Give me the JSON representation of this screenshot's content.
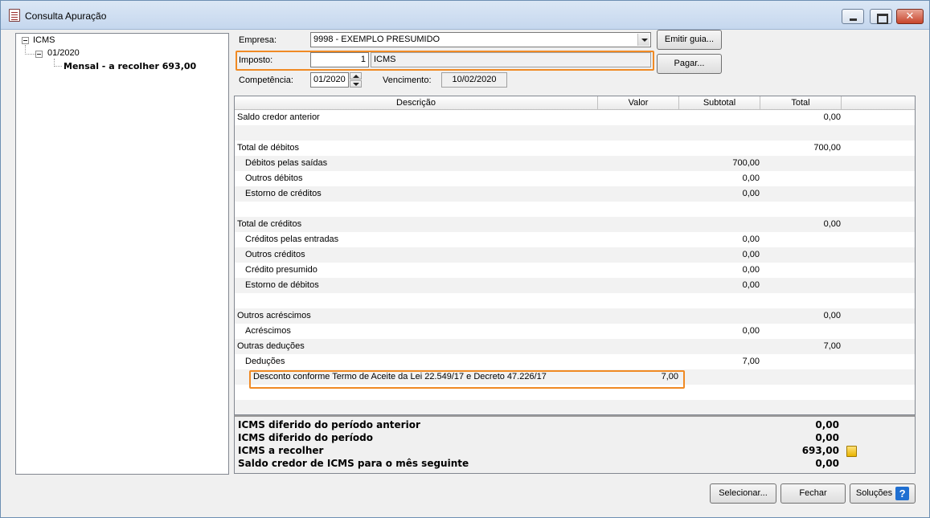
{
  "window": {
    "title": "Consulta Apuração"
  },
  "tree": {
    "root": "ICMS",
    "period": "01/2020",
    "leaf": "Mensal - a recolher 693,00"
  },
  "form": {
    "empresa_label": "Empresa:",
    "empresa_value": "9998 - EXEMPLO PRESUMIDO",
    "imposto_label": "Imposto:",
    "imposto_code": "1",
    "imposto_name": "ICMS",
    "competencia_label": "Competência:",
    "competencia_value": "01/2020",
    "vencimento_label": "Vencimento:",
    "vencimento_value": "10/02/2020",
    "emitir_guia_label": "Emitir guia...",
    "pagar_label": "Pagar..."
  },
  "grid": {
    "columns": [
      "Descrição",
      "Valor",
      "Subtotal",
      "Total"
    ],
    "rows": [
      {
        "desc": "Saldo credor anterior",
        "indent": 0,
        "valor": "",
        "subtotal": "",
        "total": "0,00"
      },
      {
        "desc": "",
        "indent": 0,
        "valor": "",
        "subtotal": "",
        "total": ""
      },
      {
        "desc": "Total de débitos",
        "indent": 0,
        "valor": "",
        "subtotal": "",
        "total": "700,00"
      },
      {
        "desc": "Débitos pelas saídas",
        "indent": 1,
        "valor": "",
        "subtotal": "700,00",
        "total": ""
      },
      {
        "desc": "Outros débitos",
        "indent": 1,
        "valor": "",
        "subtotal": "0,00",
        "total": ""
      },
      {
        "desc": "Estorno de créditos",
        "indent": 1,
        "valor": "",
        "subtotal": "0,00",
        "total": ""
      },
      {
        "desc": "",
        "indent": 0,
        "valor": "",
        "subtotal": "",
        "total": ""
      },
      {
        "desc": "Total de créditos",
        "indent": 0,
        "valor": "",
        "subtotal": "",
        "total": "0,00"
      },
      {
        "desc": "Créditos pelas entradas",
        "indent": 1,
        "valor": "",
        "subtotal": "0,00",
        "total": ""
      },
      {
        "desc": "Outros créditos",
        "indent": 1,
        "valor": "",
        "subtotal": "0,00",
        "total": ""
      },
      {
        "desc": "Crédito presumido",
        "indent": 1,
        "valor": "",
        "subtotal": "0,00",
        "total": ""
      },
      {
        "desc": "Estorno de débitos",
        "indent": 1,
        "valor": "",
        "subtotal": "0,00",
        "total": ""
      },
      {
        "desc": "",
        "indent": 0,
        "valor": "",
        "subtotal": "",
        "total": ""
      },
      {
        "desc": "Outros acréscimos",
        "indent": 0,
        "valor": "",
        "subtotal": "",
        "total": "0,00"
      },
      {
        "desc": "Acréscimos",
        "indent": 1,
        "valor": "",
        "subtotal": "0,00",
        "total": ""
      },
      {
        "desc": "Outras deduções",
        "indent": 0,
        "valor": "",
        "subtotal": "",
        "total": "7,00"
      },
      {
        "desc": "Deduções",
        "indent": 1,
        "valor": "",
        "subtotal": "7,00",
        "total": ""
      },
      {
        "desc": "Desconto conforme Termo de Aceite da Lei 22.549/17 e Decreto 47.226/17",
        "indent": 2,
        "valor": "7,00",
        "subtotal": "",
        "total": ""
      }
    ]
  },
  "summary": [
    {
      "label": "ICMS diferido do período anterior",
      "value": "0,00"
    },
    {
      "label": "ICMS diferido do período",
      "value": "0,00"
    },
    {
      "label": "ICMS a recolher",
      "value": "693,00"
    },
    {
      "label": "Saldo credor de ICMS para o mês seguinte",
      "value": "0,00"
    }
  ],
  "footer": {
    "selecionar_label": "Selecionar...",
    "fechar_label": "Fechar",
    "solucoes_label": "Soluções"
  },
  "colors": {
    "highlight": "#f08a24",
    "help_icon": "#1f6fd1"
  }
}
